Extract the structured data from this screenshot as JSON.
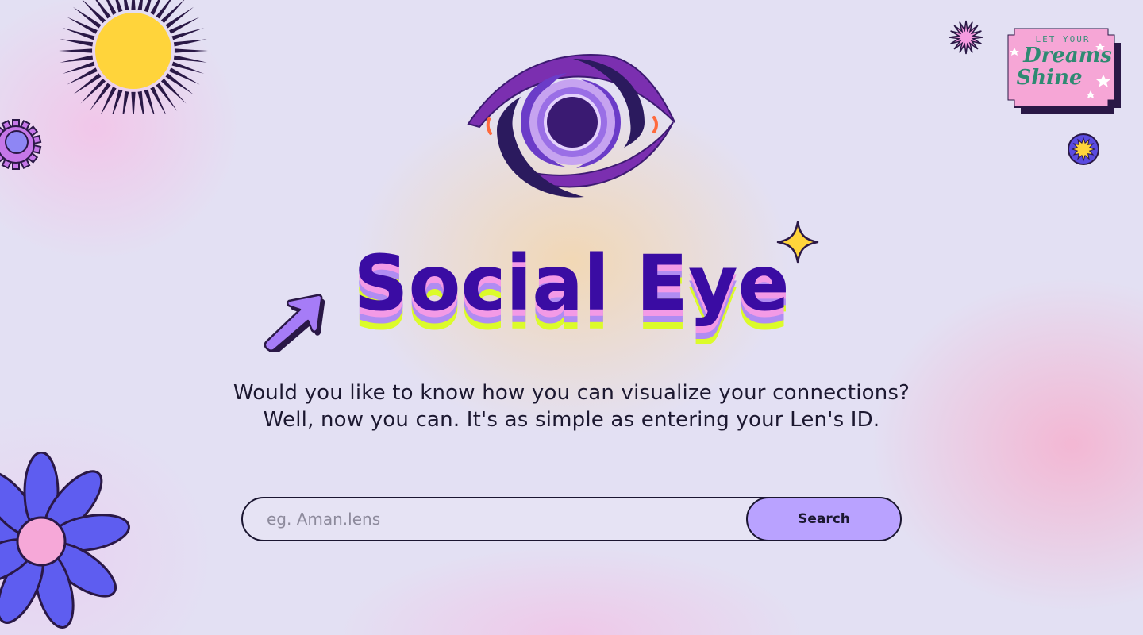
{
  "brand": {
    "title": "Social Eye"
  },
  "hero": {
    "tagline_line1": "Would you like to know how you can visualize your connections?",
    "tagline_line2": "Well, now you can. It's as simple as entering your Len's ID."
  },
  "search": {
    "placeholder": "eg. Aman.lens",
    "value": "",
    "button_label": "Search"
  },
  "sticker": {
    "line_top": "LET YOUR",
    "line_1": "Dreams",
    "line_2": "Shine"
  },
  "colors": {
    "title": "#3a0ca3",
    "title_shadow_1": "#f39ae6",
    "title_shadow_2": "#b08cf2",
    "title_shadow_3": "#dcfb2a",
    "button": "#b9a2ff",
    "eye_outer": "#7b2fb0",
    "eye_dark": "#2b1a5e",
    "sun": "#ffd43b",
    "flower_petal": "#5e5df0",
    "flower_center": "#f6a8d8"
  },
  "icons": {
    "sun": "sun-icon",
    "eye_logo": "eye-logo-icon",
    "gear": "gear-icon",
    "arrow": "arrow-icon",
    "sparkle": "sparkle-icon",
    "flower": "flower-icon",
    "starburst": "starburst-icon",
    "badge": "badge-icon"
  }
}
